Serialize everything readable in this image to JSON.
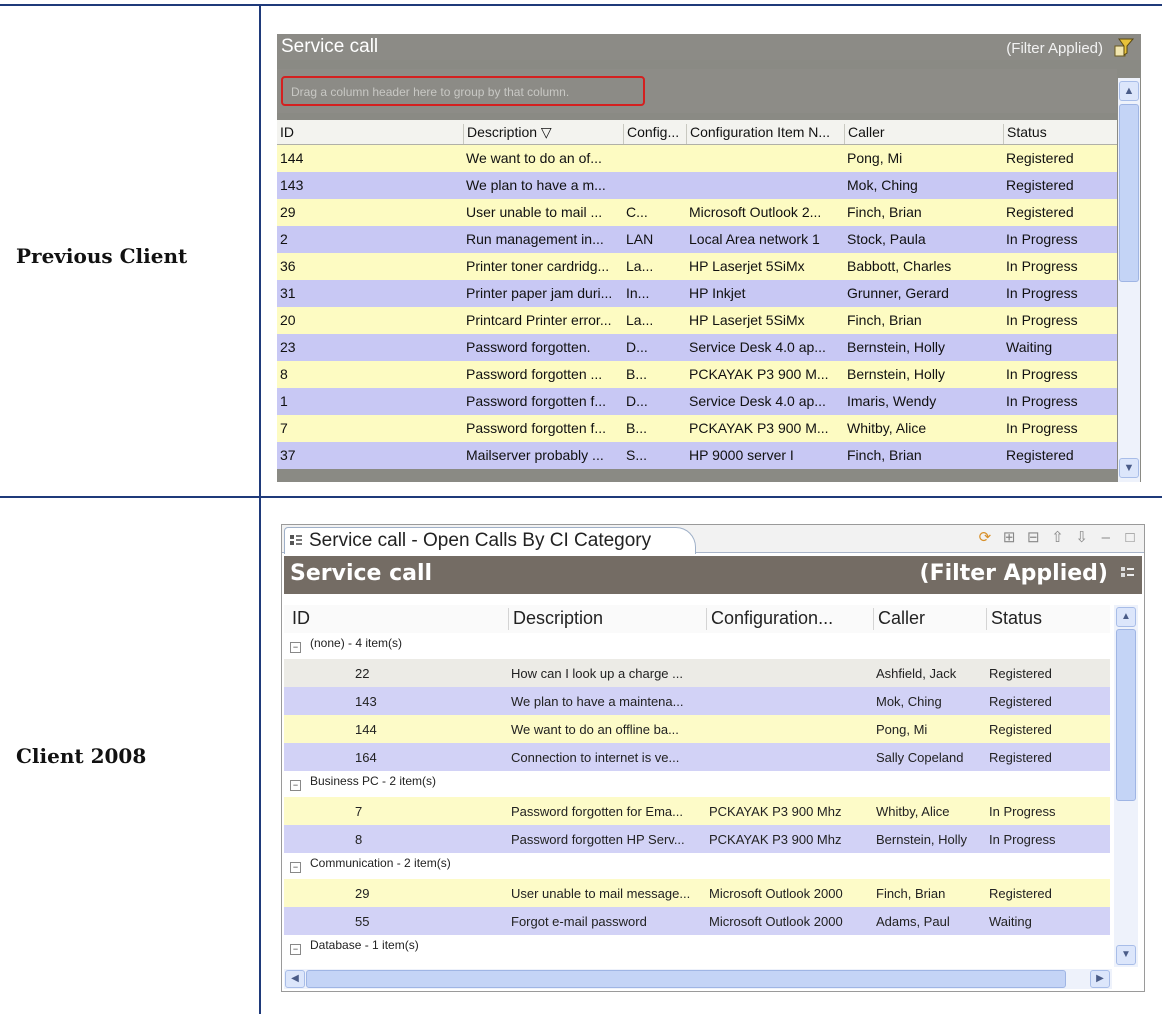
{
  "labels": {
    "previous": "Previous Client",
    "client2008": "Client 2008"
  },
  "previous": {
    "title": "Service call",
    "filter_status": "(Filter Applied)",
    "group_hint": "Drag a column header here to group by that column.",
    "columns": [
      "ID",
      "Description ▽",
      "Config...",
      "Configuration Item N...",
      "Caller",
      "Status"
    ],
    "rows": [
      [
        "144",
        "We want to do an of...",
        "",
        "",
        "Pong, Mi",
        "Registered"
      ],
      [
        "143",
        "We plan to have a m...",
        "",
        "",
        "Mok, Ching",
        "Registered"
      ],
      [
        "29",
        "User unable to mail ...",
        "C...",
        "Microsoft Outlook  2...",
        "Finch, Brian",
        "Registered"
      ],
      [
        "2",
        "Run management in...",
        "LAN",
        "Local Area network 1",
        "Stock, Paula",
        "In Progress"
      ],
      [
        "36",
        "Printer toner cardridg...",
        "La...",
        "HP Laserjet 5SiMx",
        "Babbott, Charles",
        "In Progress"
      ],
      [
        "31",
        "Printer paper jam duri...",
        "In...",
        "HP Inkjet",
        "Grunner, Gerard",
        "In Progress"
      ],
      [
        "20",
        "Printcard Printer error...",
        "La...",
        "HP Laserjet 5SiMx",
        "Finch, Brian",
        "In Progress"
      ],
      [
        "23",
        "Password forgotten.",
        "D...",
        "Service Desk 4.0 ap...",
        "Bernstein, Holly",
        "Waiting"
      ],
      [
        "8",
        "Password forgotten ...",
        "B...",
        "PCKAYAK P3 900 M...",
        "Bernstein, Holly",
        "In Progress"
      ],
      [
        "1",
        "Password forgotten f...",
        "D...",
        "Service Desk 4.0 ap...",
        "Imaris, Wendy",
        "In Progress"
      ],
      [
        "7",
        "Password forgotten f...",
        "B...",
        "PCKAYAK P3 900 M...",
        "Whitby, Alice",
        "In Progress"
      ],
      [
        "37",
        "Mailserver probably ...",
        "S...",
        "HP 9000 server I",
        "Finch, Brian",
        "Registered"
      ]
    ]
  },
  "client2008": {
    "tab_title": "Service call - Open Calls By CI Category",
    "title": "Service call",
    "filter_status": "(Filter Applied)",
    "columns": [
      "ID",
      "Description",
      "Configuration...",
      "Caller",
      "Status"
    ],
    "groups": [
      {
        "label": "(none) - 4 item(s)",
        "rows": [
          [
            "22",
            "How can I look up a charge ...",
            "",
            "Ashfield, Jack",
            "Registered"
          ],
          [
            "143",
            "We plan to have a maintena...",
            "",
            "Mok, Ching",
            "Registered"
          ],
          [
            "144",
            "We want to do an offline ba...",
            "",
            "Pong, Mi",
            "Registered"
          ],
          [
            "164",
            "Connection to internet is ve...",
            "",
            "Sally Copeland",
            "Registered"
          ]
        ]
      },
      {
        "label": "Business PC - 2 item(s)",
        "rows": [
          [
            "7",
            "Password forgotten for Ema...",
            "PCKAYAK P3 900 Mhz",
            "Whitby, Alice",
            "In Progress"
          ],
          [
            "8",
            "Password forgotten HP Serv...",
            "PCKAYAK P3 900 Mhz",
            "Bernstein, Holly",
            "In Progress"
          ]
        ]
      },
      {
        "label": "Communication - 2 item(s)",
        "rows": [
          [
            "29",
            "User unable to mail message...",
            "Microsoft Outlook  2000",
            "Finch, Brian",
            "Registered"
          ],
          [
            "55",
            "Forgot e-mail password",
            "Microsoft Outlook  2000",
            "Adams, Paul",
            "Waiting"
          ]
        ]
      },
      {
        "label": "Database - 1 item(s)",
        "rows": []
      }
    ]
  }
}
